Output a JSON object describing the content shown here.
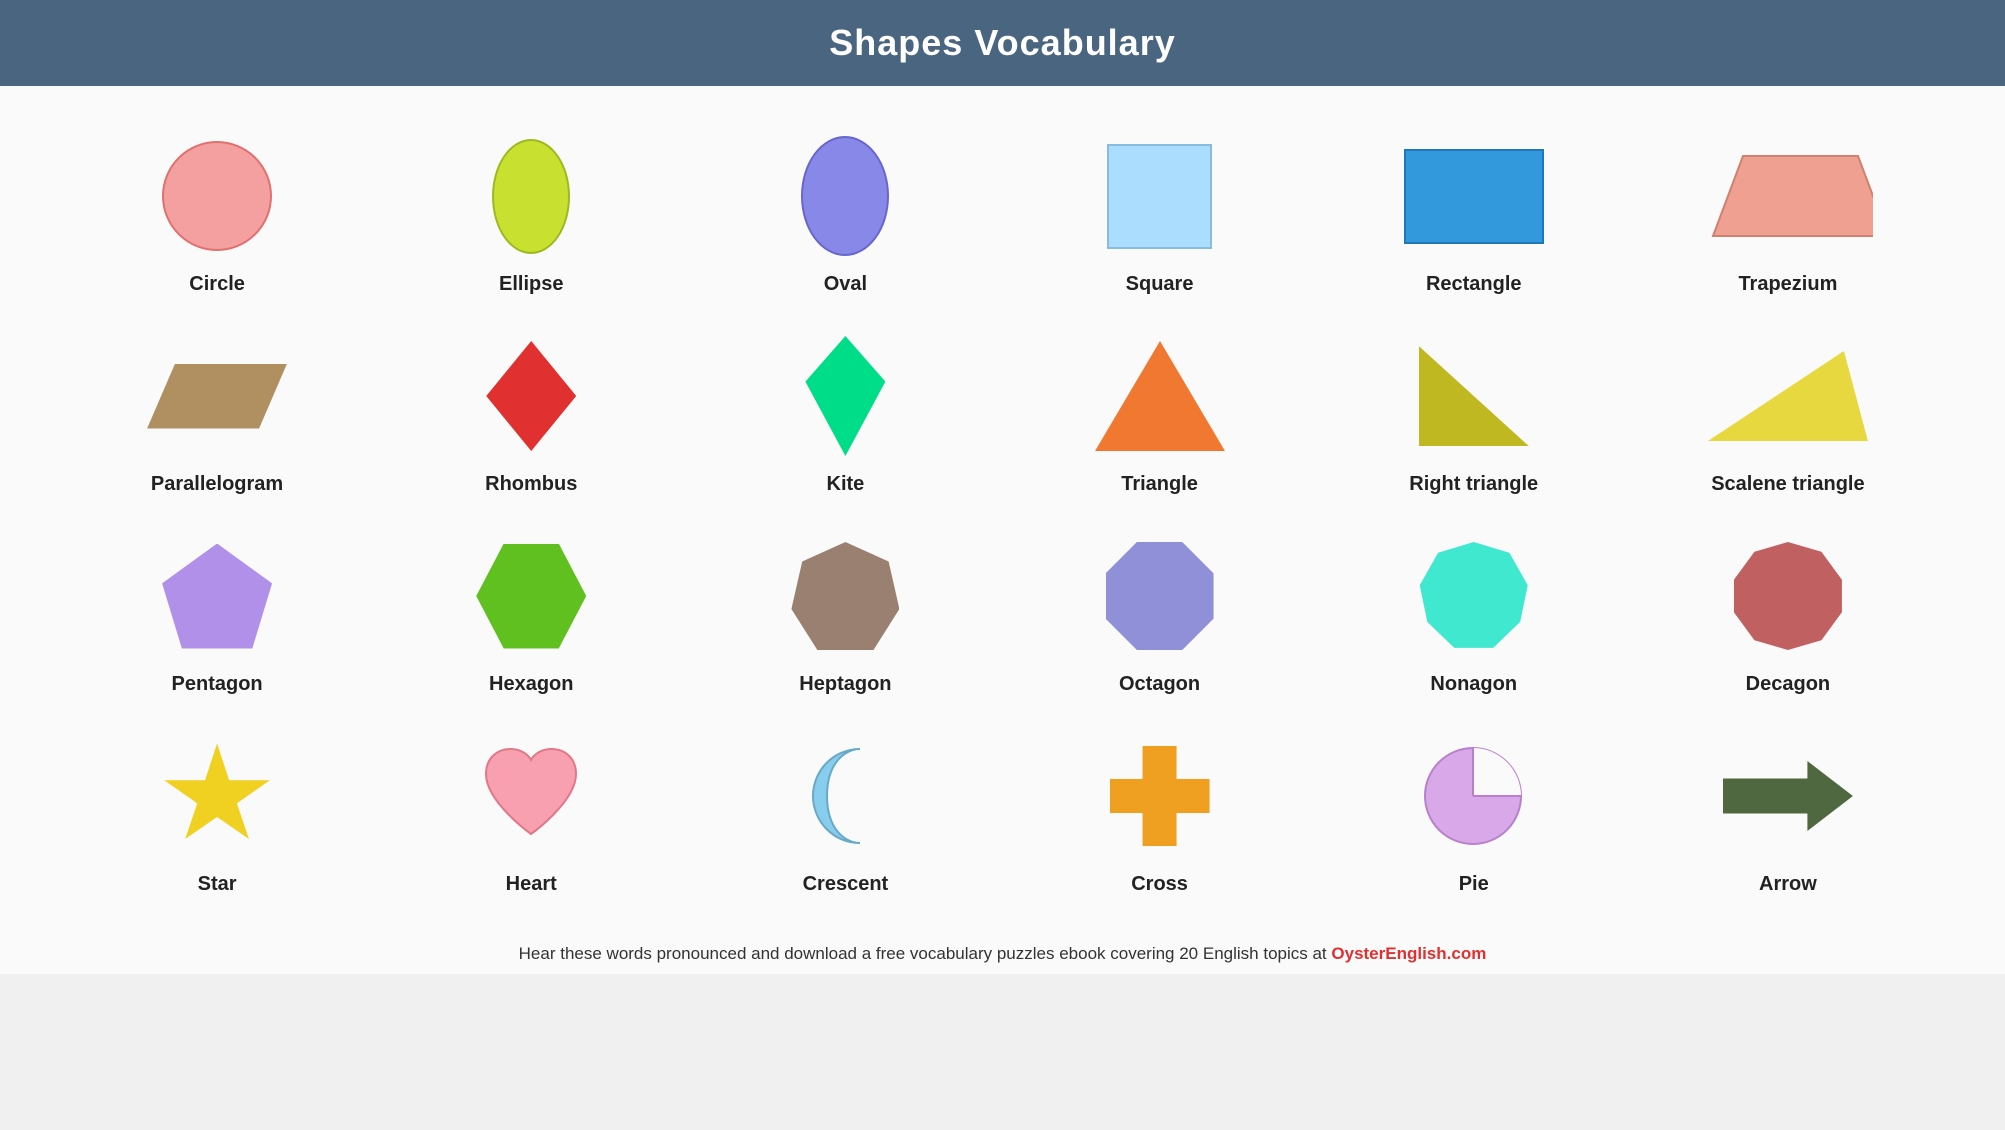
{
  "header": {
    "title": "Shapes Vocabulary"
  },
  "shapes": [
    {
      "id": "circle",
      "label": "Circle"
    },
    {
      "id": "ellipse",
      "label": "Ellipse"
    },
    {
      "id": "oval",
      "label": "Oval"
    },
    {
      "id": "square",
      "label": "Square"
    },
    {
      "id": "rectangle",
      "label": "Rectangle"
    },
    {
      "id": "trapezium",
      "label": "Trapezium"
    },
    {
      "id": "parallelogram",
      "label": "Parallelogram"
    },
    {
      "id": "rhombus",
      "label": "Rhombus"
    },
    {
      "id": "kite",
      "label": "Kite"
    },
    {
      "id": "triangle",
      "label": "Triangle"
    },
    {
      "id": "right-triangle",
      "label": "Right triangle"
    },
    {
      "id": "scalene-triangle",
      "label": "Scalene triangle"
    },
    {
      "id": "pentagon",
      "label": "Pentagon"
    },
    {
      "id": "hexagon",
      "label": "Hexagon"
    },
    {
      "id": "heptagon",
      "label": "Heptagon"
    },
    {
      "id": "octagon",
      "label": "Octagon"
    },
    {
      "id": "nonagon",
      "label": "Nonagon"
    },
    {
      "id": "decagon",
      "label": "Decagon"
    },
    {
      "id": "star",
      "label": "Star"
    },
    {
      "id": "heart",
      "label": "Heart"
    },
    {
      "id": "crescent",
      "label": "Crescent"
    },
    {
      "id": "cross",
      "label": "Cross"
    },
    {
      "id": "pie",
      "label": "Pie"
    },
    {
      "id": "arrow",
      "label": "Arrow"
    }
  ],
  "footer": {
    "text": "Hear these words pronounced and download a free vocabulary puzzles ebook covering 20 English topics at ",
    "link": "OysterEnglish.com"
  }
}
